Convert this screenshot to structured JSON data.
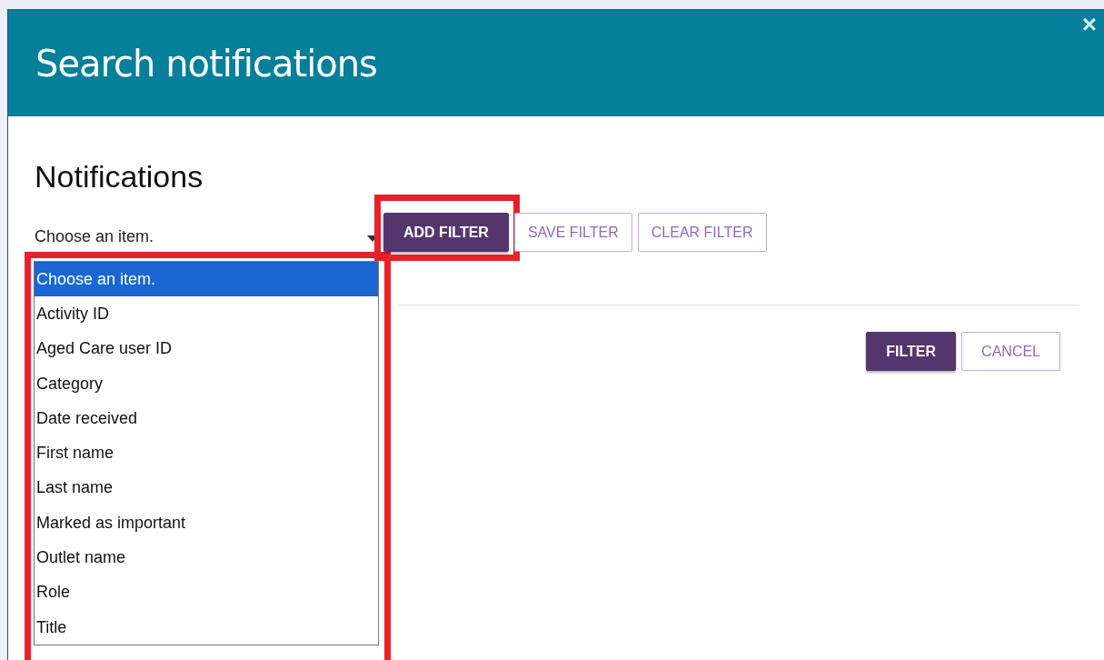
{
  "dialog": {
    "title": "Search notifications",
    "close": "×"
  },
  "heading": "Notifications",
  "select": {
    "value": "Choose an item.",
    "expanded": true,
    "highlighted": true,
    "options": [
      {
        "label": "Choose an item.",
        "selected": true
      },
      {
        "label": "Activity ID",
        "selected": false
      },
      {
        "label": "Aged Care user ID",
        "selected": false
      },
      {
        "label": "Category",
        "selected": false
      },
      {
        "label": "Date received",
        "selected": false
      },
      {
        "label": "First name",
        "selected": false
      },
      {
        "label": "Last name",
        "selected": false
      },
      {
        "label": "Marked as important",
        "selected": false
      },
      {
        "label": "Outlet name",
        "selected": false
      },
      {
        "label": "Role",
        "selected": false
      },
      {
        "label": "Title",
        "selected": false
      }
    ]
  },
  "filter_buttons": [
    {
      "label": "ADD FILTER",
      "kind": "primary",
      "highlighted": true
    },
    {
      "label": "SAVE FILTER",
      "kind": "secondary",
      "highlighted": false
    },
    {
      "label": "CLEAR FILTER",
      "kind": "secondary",
      "highlighted": false
    }
  ],
  "action_buttons": [
    {
      "label": "FILTER",
      "kind": "primary"
    },
    {
      "label": "CANCEL",
      "kind": "secondary"
    }
  ]
}
